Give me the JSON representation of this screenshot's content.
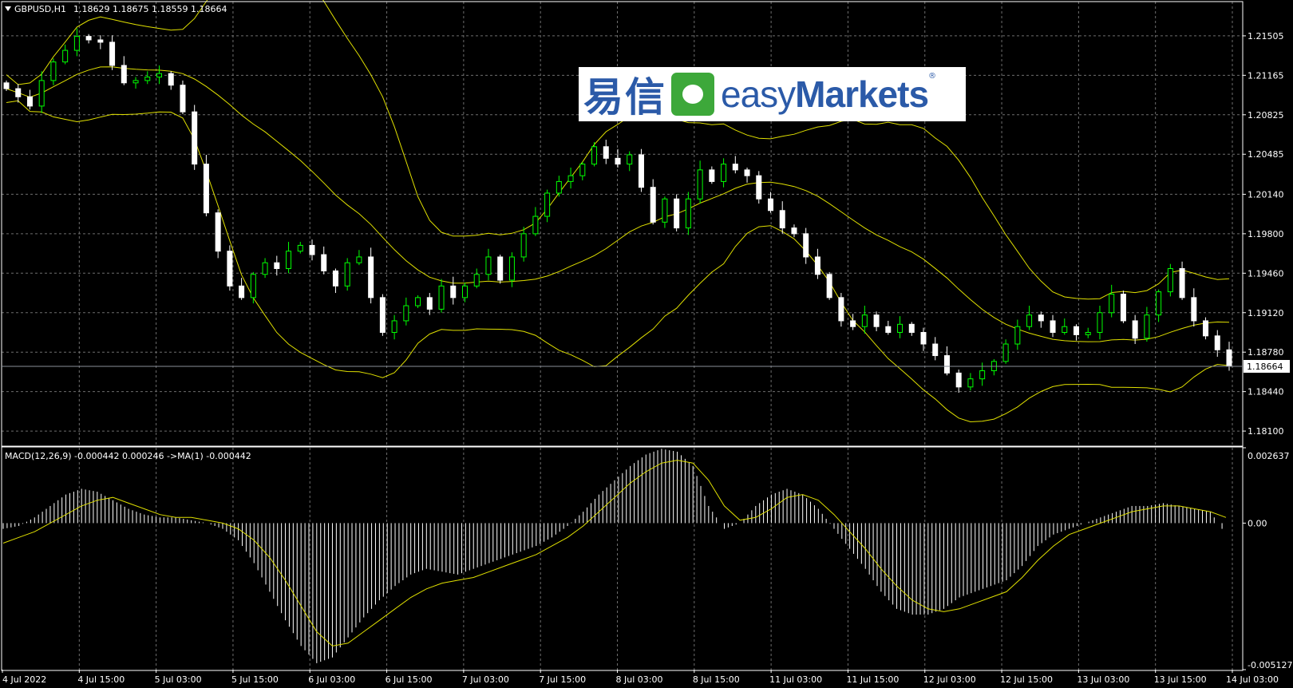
{
  "main_header": {
    "symbol": "GBPUSD,H1",
    "ohlc": "1.18629 1.18675 1.18559 1.18664"
  },
  "macd_header": {
    "label": "MACD(12,26,9) -0.000442 0.000246  ->MA(1) -0.000442"
  },
  "logo": {
    "cn": "易信",
    "en_light": "easy",
    "en_bold": "Markets",
    "reg": "®"
  },
  "current_price_label": "1.18664",
  "colors": {
    "background": "#000000",
    "grid": "#6e6e6e",
    "bull_candle": "#00ff00",
    "bear_candle": "#ffffff",
    "bands": "#e0e000",
    "macd_histogram": "#ffffff",
    "macd_signal": "#e0e000",
    "text": "#ffffff",
    "logo_blue": "#2b5aa8",
    "logo_green": "#3da83a"
  },
  "chart_data": [
    {
      "type": "candlestick",
      "title": "GBPUSD,H1",
      "y_ticks": [
        "1.21505",
        "1.21165",
        "1.20825",
        "1.20485",
        "1.20140",
        "1.19800",
        "1.19460",
        "1.19120",
        "1.18780",
        "1.18440",
        "1.18100"
      ],
      "ylim": [
        1.1797,
        1.218
      ],
      "x_ticks": [
        "4 Jul 2022",
        "4 Jul 15:00",
        "5 Jul 03:00",
        "5 Jul 15:00",
        "6 Jul 03:00",
        "6 Jul 15:00",
        "7 Jul 03:00",
        "7 Jul 15:00",
        "8 Jul 03:00",
        "8 Jul 15:00",
        "11 Jul 03:00",
        "11 Jul 15:00",
        "12 Jul 03:00",
        "12 Jul 15:00",
        "13 Jul 03:00",
        "13 Jul 15:00",
        "14 Jul 03:00"
      ],
      "grid": true,
      "indicator": "Bollinger Bands",
      "current_price": 1.18664,
      "close_approx": [
        1.2105,
        1.2098,
        1.209,
        1.2112,
        1.2128,
        1.2138,
        1.215,
        1.2147,
        1.2145,
        1.2125,
        1.211,
        1.2112,
        1.2115,
        1.2118,
        1.2108,
        1.2085,
        1.204,
        1.1998,
        1.1965,
        1.1935,
        1.1925,
        1.1945,
        1.1955,
        1.195,
        1.1965,
        1.197,
        1.1962,
        1.1948,
        1.1935,
        1.1955,
        1.196,
        1.1925,
        1.1895,
        1.1905,
        1.1918,
        1.1925,
        1.1915,
        1.1935,
        1.1925,
        1.1935,
        1.1945,
        1.196,
        1.194,
        1.196,
        1.198,
        1.1995,
        1.2015,
        1.2025,
        1.203,
        1.204,
        1.2055,
        1.2045,
        1.204,
        1.2048,
        1.202,
        1.199,
        1.201,
        1.1985,
        1.201,
        1.2035,
        1.2025,
        1.204,
        1.2035,
        1.203,
        1.201,
        1.2,
        1.1985,
        1.198,
        1.196,
        1.1945,
        1.1925,
        1.1905,
        1.19,
        1.191,
        1.19,
        1.1895,
        1.1902,
        1.1895,
        1.1885,
        1.1875,
        1.186,
        1.1848,
        1.1855,
        1.1862,
        1.187,
        1.1885,
        1.19,
        1.191,
        1.1905,
        1.1895,
        1.19,
        1.1893,
        1.1895,
        1.1912,
        1.1928,
        1.1905,
        1.189,
        1.191,
        1.193,
        1.195,
        1.1925,
        1.1905,
        1.1892,
        1.188,
        1.1866
      ]
    },
    {
      "type": "histogram",
      "title": "MACD(12,26,9)",
      "y_ticks": [
        "0.002637",
        "0.00",
        "-0.005127"
      ],
      "ylim": [
        -0.005127,
        0.002637
      ],
      "macd_approx": [
        -0.0002,
        -0.0001,
        0.0002,
        0.0006,
        0.001,
        0.0012,
        0.0011,
        0.0008,
        0.0005,
        0.0003,
        0.0002,
        0.0002,
        0.0001,
        0.0,
        -0.0002,
        -0.0006,
        -0.0014,
        -0.0024,
        -0.0034,
        -0.0043,
        -0.0049,
        -0.0047,
        -0.004,
        -0.0033,
        -0.0027,
        -0.0022,
        -0.0018,
        -0.0016,
        -0.0017,
        -0.0018,
        -0.0016,
        -0.0014,
        -0.0012,
        -0.001,
        -0.0008,
        -0.0005,
        -0.0001,
        0.0004,
        0.001,
        0.0015,
        0.002,
        0.0024,
        0.0026,
        0.0025,
        0.002,
        0.0006,
        -0.0002,
        0.0,
        0.0006,
        0.001,
        0.0012,
        0.001,
        0.0005,
        -0.0002,
        -0.0009,
        -0.0016,
        -0.0024,
        -0.003,
        -0.0032,
        -0.0032,
        -0.003,
        -0.0026,
        -0.0024,
        -0.0022,
        -0.002,
        -0.0015,
        -0.0008,
        -0.0004,
        -0.0002,
        0.0,
        0.0002,
        0.0004,
        0.0006,
        0.0006,
        0.0007,
        0.0006,
        0.0005,
        0.0004,
        -0.0004
      ],
      "signal_approx": [
        -0.0007,
        -0.0005,
        -0.0003,
        0.0,
        0.0003,
        0.0006,
        0.0008,
        0.0009,
        0.0007,
        0.0005,
        0.0003,
        0.0002,
        0.0002,
        0.0001,
        0.0,
        -0.0002,
        -0.0006,
        -0.0012,
        -0.002,
        -0.0029,
        -0.0038,
        -0.0043,
        -0.0042,
        -0.0038,
        -0.0034,
        -0.003,
        -0.0026,
        -0.0023,
        -0.0021,
        -0.002,
        -0.0019,
        -0.0017,
        -0.0015,
        -0.0013,
        -0.0011,
        -0.0008,
        -0.0005,
        -0.0001,
        0.0004,
        0.0009,
        0.0014,
        0.0018,
        0.0021,
        0.0022,
        0.0021,
        0.0015,
        0.0006,
        0.0001,
        0.0002,
        0.0005,
        0.0009,
        0.001,
        0.0008,
        0.0003,
        -0.0003,
        -0.0009,
        -0.0016,
        -0.0022,
        -0.0027,
        -0.003,
        -0.0031,
        -0.003,
        -0.0028,
        -0.0026,
        -0.0024,
        -0.0019,
        -0.0013,
        -0.0008,
        -0.0004,
        -0.0002,
        0.0,
        0.0002,
        0.0004,
        0.0005,
        0.0006,
        0.0006,
        0.0005,
        0.0004,
        0.0002
      ]
    }
  ]
}
